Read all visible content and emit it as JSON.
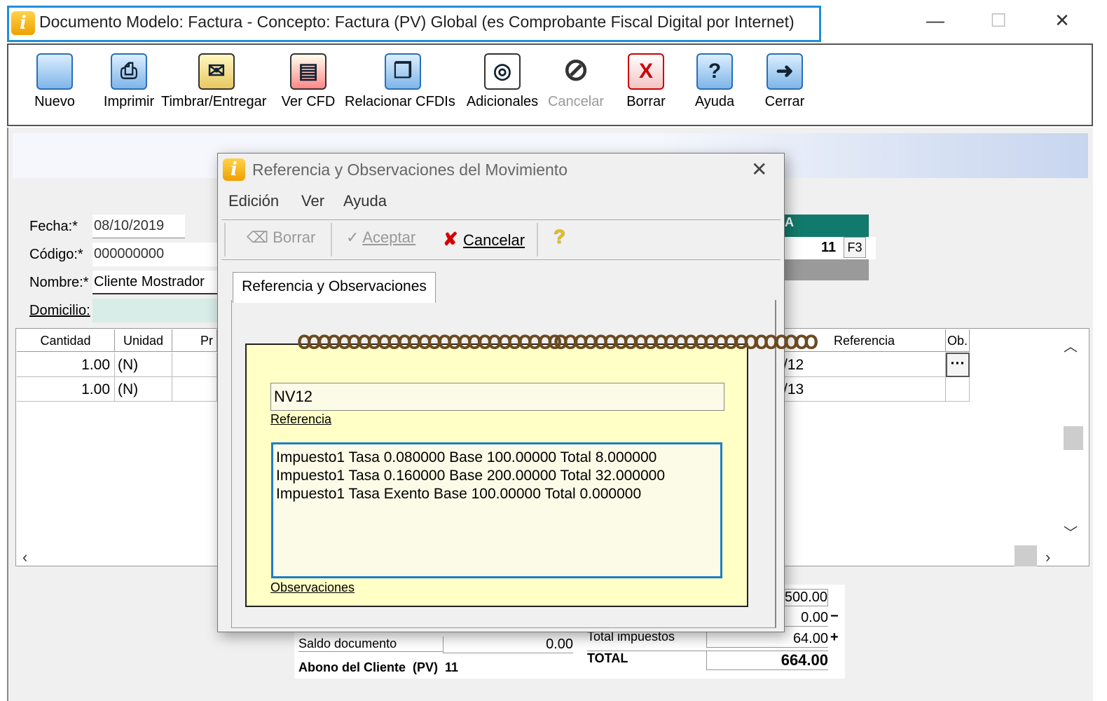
{
  "window": {
    "title": "Documento Modelo: Factura - Concepto: Factura (PV) Global (es Comprobante Fiscal Digital por Internet)",
    "controls": {
      "minimize": "—",
      "maximize": "☐",
      "close": "✕"
    }
  },
  "toolbar": {
    "items": [
      {
        "label": "Nuevo",
        "icon": "new-document-icon"
      },
      {
        "label": "Imprimir",
        "icon": "printer-icon"
      },
      {
        "label": "Timbrar/Entregar",
        "icon": "stamp-deliver-icon"
      },
      {
        "label": "Ver CFD",
        "icon": "view-cfd-icon"
      },
      {
        "label": "Relacionar CFDIs",
        "icon": "relate-cfdi-icon"
      },
      {
        "label": "Adicionales",
        "icon": "additional-icon"
      },
      {
        "label": "Cancelar",
        "icon": "cancel-circle-icon"
      },
      {
        "label": "Borrar",
        "icon": "delete-x-icon"
      },
      {
        "label": "Ayuda",
        "icon": "help-icon"
      },
      {
        "label": "Cerrar",
        "icon": "exit-door-icon"
      }
    ]
  },
  "form": {
    "fecha_label": "Fecha:*",
    "fecha_value": "08/10/2019",
    "codigo_label": "Código:*",
    "codigo_value": "000000000",
    "nombre_label": "Nombre:*",
    "nombre_value": "Cliente Mostrador",
    "domicilio_label": "Domicilio:",
    "dock_value": "11",
    "dock_key": "F3",
    "dock_header": "A"
  },
  "grid": {
    "headers": [
      "Cantidad",
      "Unidad",
      "Pr",
      "Referencia",
      "Ob."
    ],
    "rows": [
      {
        "cantidad": "1.00",
        "unidad": "(N)",
        "referencia": "/12",
        "ob": "···"
      },
      {
        "cantidad": "1.00",
        "unidad": "(N)",
        "referencia": "/13",
        "ob": ""
      }
    ]
  },
  "totals": {
    "subtotal": "500.00",
    "descuento": "0.00",
    "impuestos_label": "Total impuestos",
    "impuestos": "64.00",
    "total_label": "TOTAL",
    "total": "664.00",
    "saldo_label": "Saldo documento",
    "saldo": "0.00",
    "abono_label": "Abono del Cliente  (PV)  11",
    "minus_sign": "−",
    "plus_sign": "+"
  },
  "dialog": {
    "title": "Referencia y Observaciones del Movimiento",
    "menu": [
      "Edición",
      "Ver",
      "Ayuda"
    ],
    "toolbar": {
      "borrar": "Borrar",
      "aceptar": "Aceptar",
      "cancelar": "Cancelar"
    },
    "tab": "Referencia y Observaciones",
    "referencia_value": "NV12",
    "referencia_label": "Referencia",
    "observaciones_value": "Impuesto1 Tasa 0.080000 Base 100.00000 Total 8.000000\nImpuesto1 Tasa 0.160000 Base 200.00000 Total 32.000000\nImpuesto1 Tasa Exento Base 100.00000 Total 0.000000",
    "observaciones_label": "Observaciones"
  },
  "colors": {
    "accent": "#1e90d6",
    "dock_header": "#127a6c",
    "notepad": "#ffffc6"
  }
}
